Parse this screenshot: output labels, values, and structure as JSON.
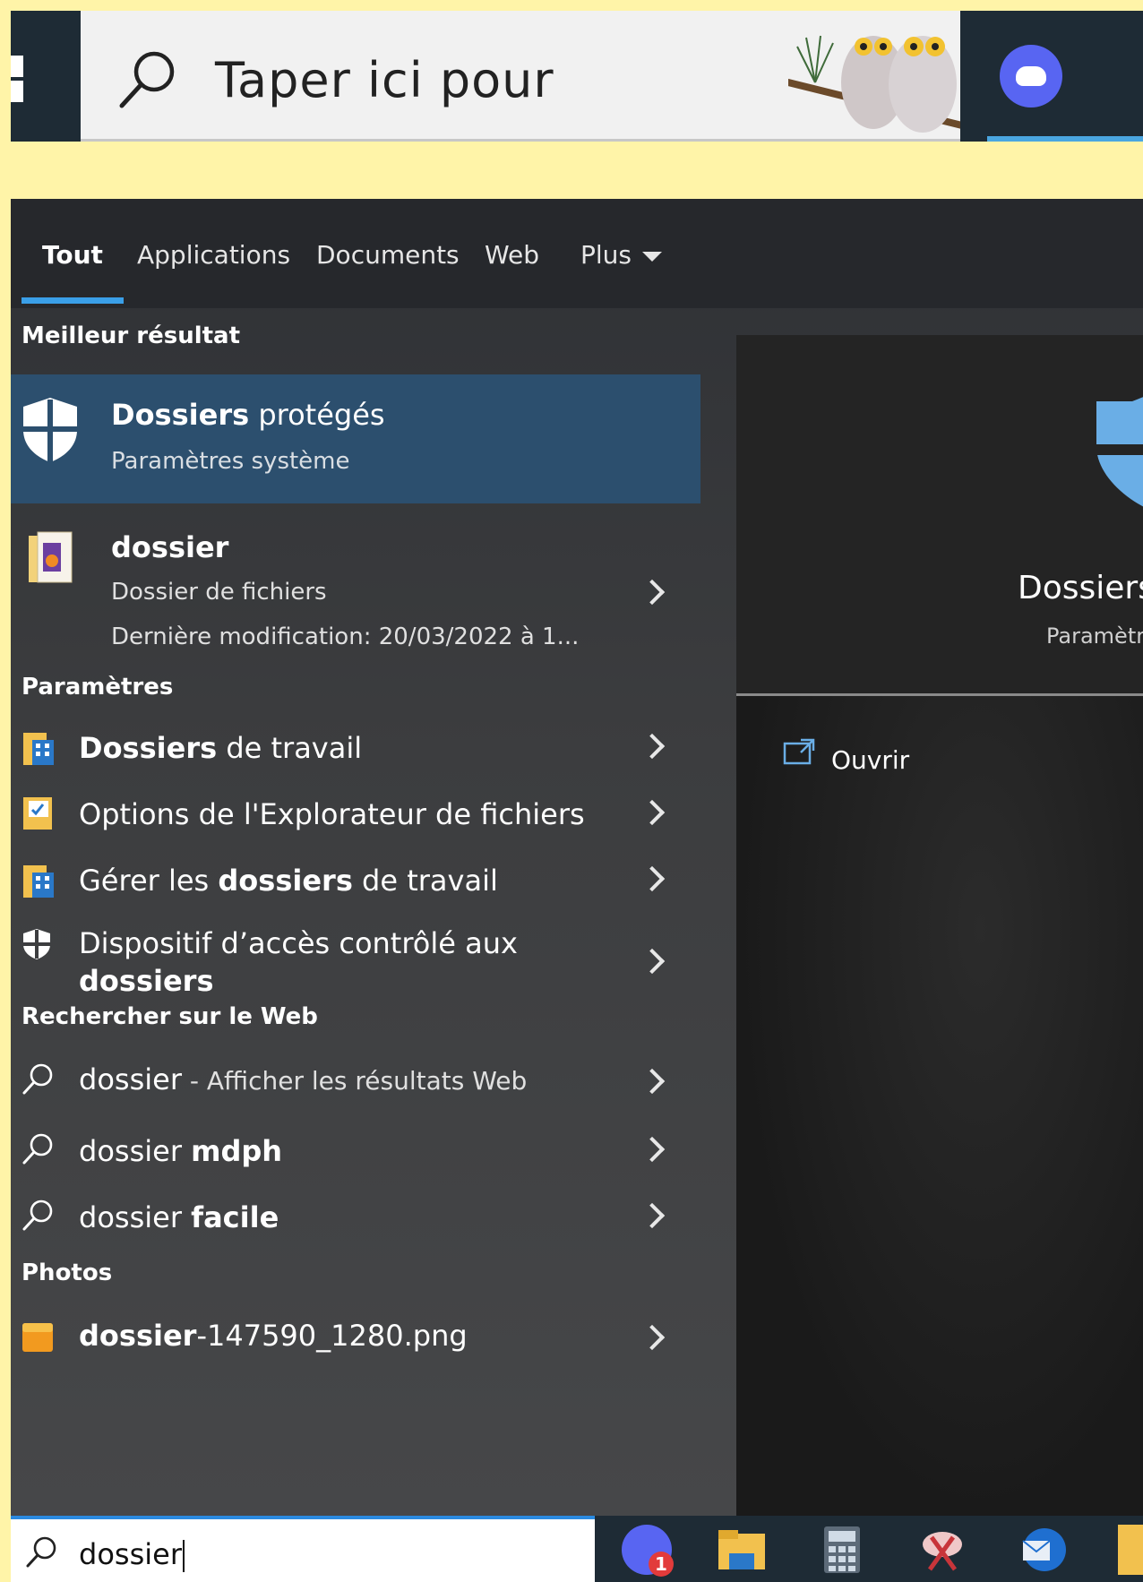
{
  "top_bar": {
    "search_placeholder": "Taper ici pour"
  },
  "tabs": [
    {
      "label": "Tout",
      "active": true
    },
    {
      "label": "Applications"
    },
    {
      "label": "Documents"
    },
    {
      "label": "Web"
    },
    {
      "label": "Plus"
    }
  ],
  "best_match": {
    "section": "Meilleur résultat",
    "title_bold": "Dossiers",
    "title_rest": " protégés",
    "subtitle": "Paramètres système"
  },
  "folder_result": {
    "title": "dossier",
    "type": "Dossier de fichiers",
    "modified": "Dernière modification: 20/03/2022 à 1..."
  },
  "settings": {
    "section": "Paramètres",
    "items": [
      {
        "bold": "Dossiers",
        "rest": " de travail"
      },
      {
        "pre": "Options de l'Explorateur de fichiers"
      },
      {
        "pre": "Gérer les ",
        "bold": "dossiers",
        "rest": " de travail"
      },
      {
        "pre": "Dispositif d’accès contrôlé aux",
        "bold": "dossiers"
      }
    ]
  },
  "web": {
    "section": "Rechercher sur le Web",
    "items": [
      {
        "pre": "dossier",
        "sub": " - Afficher les résultats Web"
      },
      {
        "pre": "dossier ",
        "bold": "mdph"
      },
      {
        "pre": "dossier ",
        "bold": "facile"
      }
    ]
  },
  "photos": {
    "section": "Photos",
    "items": [
      {
        "bold": "dossier",
        "rest": "-147590_1280.png"
      }
    ]
  },
  "preview": {
    "title": "Dossiers",
    "subtitle": "Paramètr",
    "open_label": "Ouvrir"
  },
  "bottom_search": {
    "query": "dossier"
  },
  "taskbar": {
    "discord_badge": "1"
  },
  "colors": {
    "accent": "#3a9fe8",
    "selection": "#2c4f6e",
    "page_bg": "#fff4a8"
  }
}
